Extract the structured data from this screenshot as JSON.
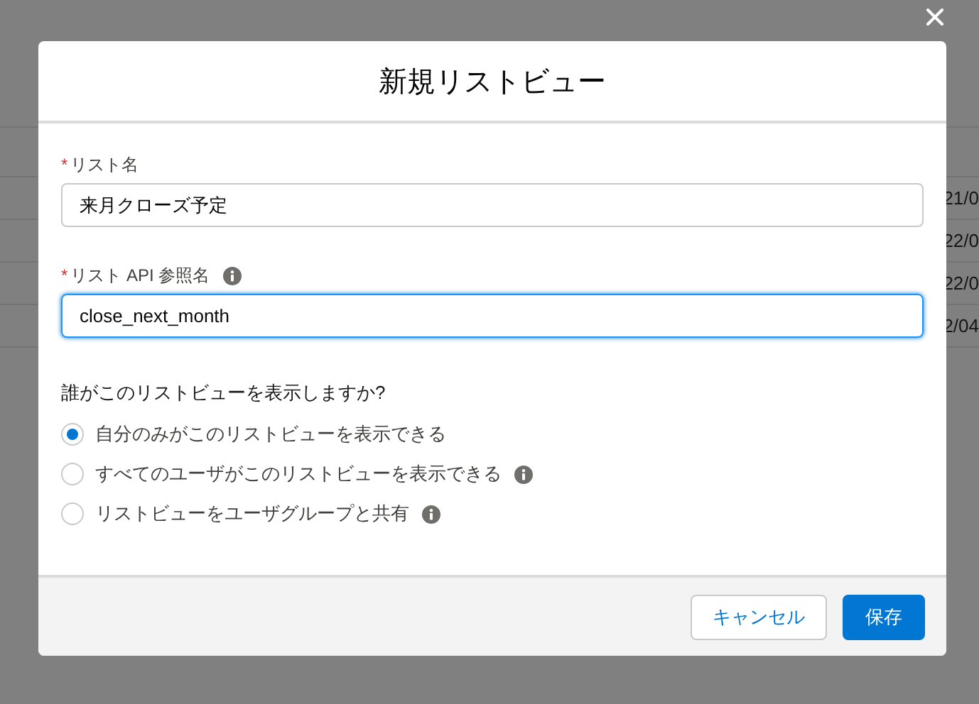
{
  "background_table": {
    "column_cells": [
      "21/0",
      "22/0",
      "22/0",
      "2/04"
    ]
  },
  "modal": {
    "title": "新規リストビュー",
    "fields": [
      {
        "label": "リスト名",
        "required_mark": "*",
        "info": false,
        "value": "来月クローズ予定",
        "focused": false
      },
      {
        "label": "リスト API 参照名",
        "required_mark": "*",
        "info": true,
        "value": "close_next_month",
        "focused": true
      }
    ],
    "visibility": {
      "question": "誰がこのリストビューを表示しますか?",
      "options": [
        {
          "label": "自分のみがこのリストビューを表示できる",
          "selected": true,
          "info": false
        },
        {
          "label": "すべてのユーザがこのリストビューを表示できる",
          "selected": false,
          "info": true
        },
        {
          "label": "リストビューをユーザグループと共有",
          "selected": false,
          "info": true
        }
      ]
    },
    "buttons": [
      {
        "label": "キャンセル",
        "kind": "neutral"
      },
      {
        "label": "保存",
        "kind": "brand"
      }
    ]
  }
}
